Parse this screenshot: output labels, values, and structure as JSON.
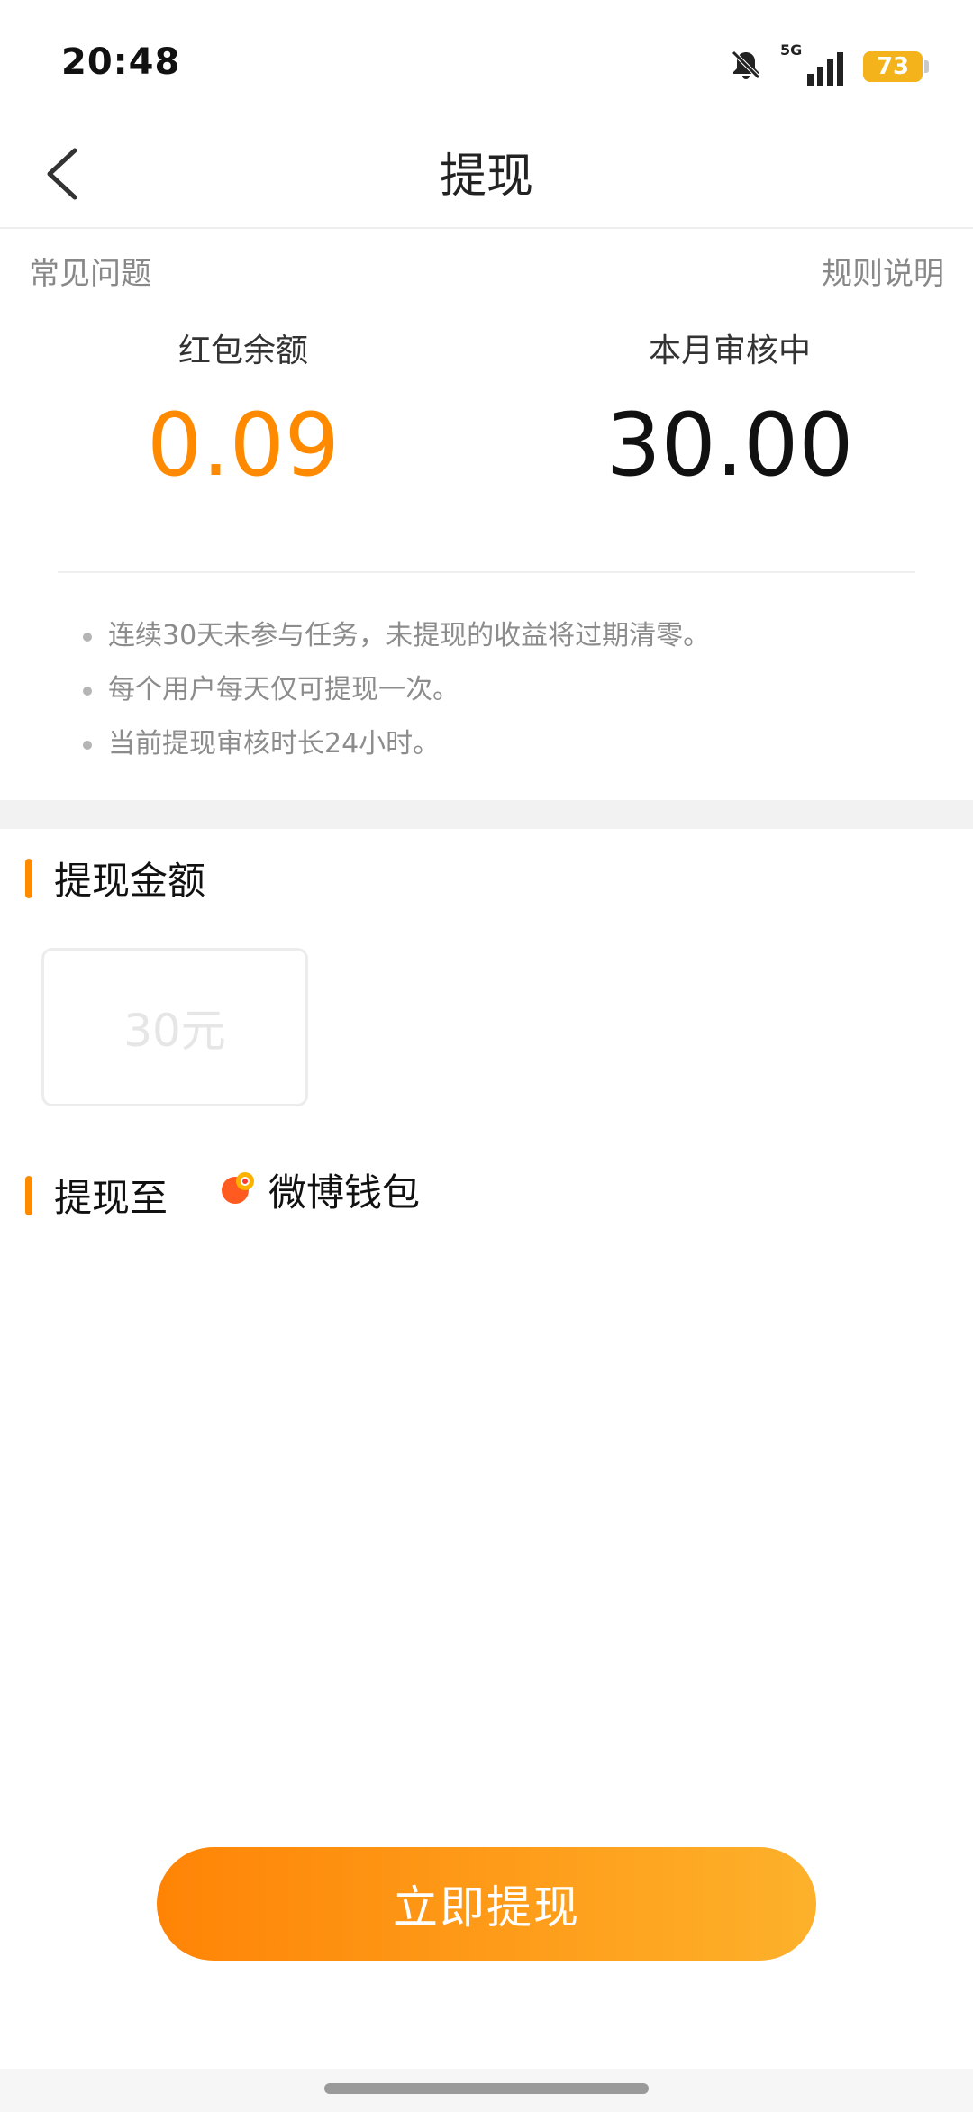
{
  "status_bar": {
    "time": "20:48",
    "network": "5G",
    "battery": "73",
    "icons": [
      "bell-muted-icon",
      "signal-icon",
      "battery-icon"
    ]
  },
  "header": {
    "title": "提现",
    "back_icon": "chevron-left-icon"
  },
  "links": {
    "faq": "常见问题",
    "rules": "规则说明"
  },
  "balances": {
    "red_packet_label": "红包余额",
    "red_packet_value": "0.09",
    "reviewing_label": "本月审核中",
    "reviewing_value": "30.00"
  },
  "notes": [
    "连续30天未参与任务，未提现的收益将过期清零。",
    "每个用户每天仅可提现一次。",
    "当前提现审核时长24小时。"
  ],
  "amount_section": {
    "title": "提现金额",
    "options": [
      "30元"
    ]
  },
  "destination": {
    "title": "提现至",
    "wallet": "微博钱包",
    "wallet_icon": "weibo-wallet-icon"
  },
  "submit_label": "立即提现",
  "colors": {
    "accent": "#ff8a00",
    "button_start": "#ff8406",
    "button_end": "#fdb12b",
    "battery": "#f4b21b"
  }
}
